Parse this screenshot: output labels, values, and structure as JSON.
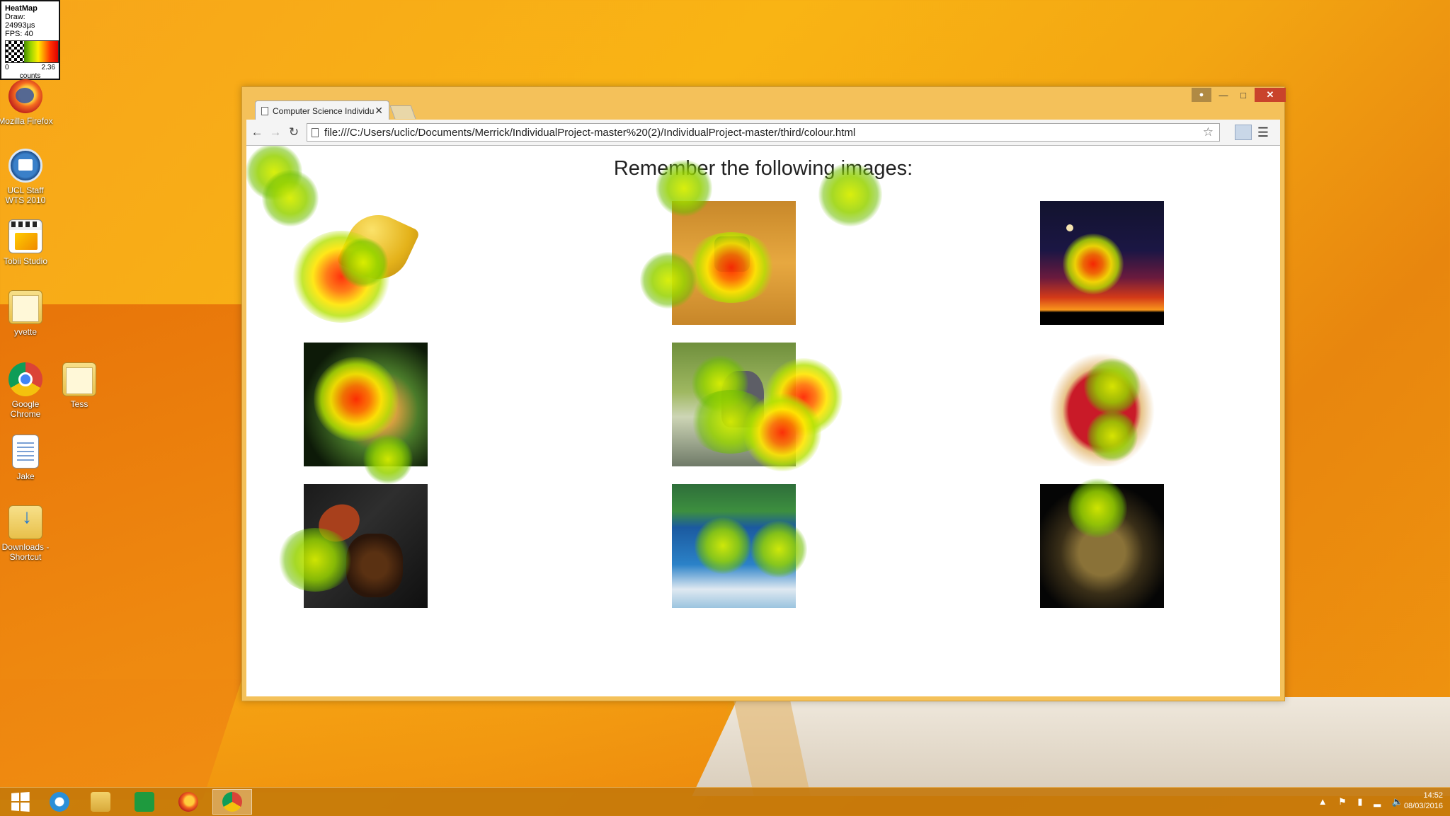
{
  "heatmap_widget": {
    "title": "HeatMap",
    "draw": "Draw: 24993µs",
    "fps": "FPS: 40",
    "range_min": "0",
    "range_max": "2.36",
    "unit": "counts"
  },
  "desktop_icons": [
    {
      "label": "Mozilla Firefox",
      "icon": "firefox-icon"
    },
    {
      "label": "UCL Staff WTS 2010",
      "icon": "remote-desktop-icon"
    },
    {
      "label": "Tobii Studio",
      "icon": "tobii-studio-icon"
    },
    {
      "label": "yvette",
      "icon": "folder-icon"
    },
    {
      "label": "Google Chrome",
      "icon": "chrome-icon"
    },
    {
      "label": "Tess",
      "icon": "folder-icon"
    },
    {
      "label": "Jake",
      "icon": "file-icon"
    },
    {
      "label": "Downloads - Shortcut",
      "icon": "downloads-folder-icon"
    }
  ],
  "browser": {
    "tab_title": "Computer Science Individu",
    "url": "file:///C:/Users/uclic/Documents/Merrick/IndividualProject-master%20(2)/IndividualProject-master/third/colour.html"
  },
  "page": {
    "heading": "Remember the following images:",
    "images": [
      "bananas",
      "feet in desert sand",
      "sunset with moon",
      "toy figure on grass",
      "donkey",
      "strawberry tart",
      "spilled coffee beans",
      "jet ski rider",
      "pearl jewellery"
    ]
  },
  "taskbar": {
    "apps": [
      "start-icon",
      "internet-explorer-icon",
      "file-explorer-icon",
      "store-icon",
      "firefox-icon",
      "chrome-icon"
    ],
    "active_app": "chrome-icon",
    "time": "14:52",
    "date": "08/03/2016"
  },
  "colors": {
    "heat_low": "#9bd400",
    "heat_mid": "#ffee00",
    "heat_high": "#ff3300",
    "window_frame": "#f4c15a",
    "close_button": "#c9432b"
  }
}
